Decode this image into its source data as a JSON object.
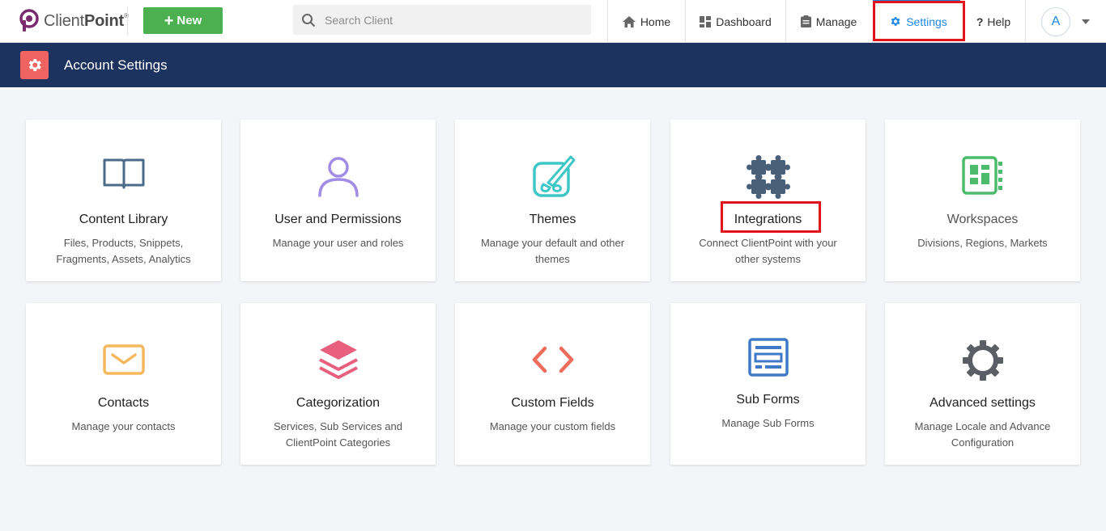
{
  "brand": {
    "name_light": "Client",
    "name_bold": "Point",
    "trademark": "®"
  },
  "toolbar": {
    "new_label": "New"
  },
  "search": {
    "placeholder": "Search Client"
  },
  "nav": {
    "home": "Home",
    "dashboard": "Dashboard",
    "manage": "Manage",
    "settings": "Settings",
    "help": "Help"
  },
  "user": {
    "avatar_initial": "A"
  },
  "page": {
    "title": "Account Settings"
  },
  "colors": {
    "accent": "#1e88e5",
    "new_button": "#4caf50",
    "header_band": "#1c3360",
    "header_icon": "#ef6461",
    "highlight": "#e0141a"
  },
  "cards": [
    {
      "title": "Content Library",
      "desc": "Files, Products, Snippets, Fragments, Assets, Analytics",
      "icon": "book-icon",
      "icon_color": "#4a6b8a"
    },
    {
      "title": "User and Permissions",
      "desc": "Manage your user and roles",
      "icon": "user-icon",
      "icon_color": "#a18ce6"
    },
    {
      "title": "Themes",
      "desc": "Manage your default and other themes",
      "icon": "palette-brush-icon",
      "icon_color": "#3fc6c6"
    },
    {
      "title": "Integrations",
      "desc": "Connect ClientPoint with your other systems",
      "icon": "puzzle-icon",
      "icon_color": "#4a5f78"
    },
    {
      "title": "Workspaces",
      "desc": "Divisions, Regions, Markets",
      "icon": "workspace-icon",
      "icon_color": "#4cbb6c"
    },
    {
      "title": "Contacts",
      "desc": "Manage your contacts",
      "icon": "envelope-icon",
      "icon_color": "#f5b860"
    },
    {
      "title": "Categorization",
      "desc": "Services, Sub Services and ClientPoint Categories",
      "icon": "layers-icon",
      "icon_color": "#e8607e"
    },
    {
      "title": "Custom Fields",
      "desc": "Manage your custom fields",
      "icon": "code-icon",
      "icon_color": "#ee6c5c"
    },
    {
      "title": "Sub Forms",
      "desc": "Manage Sub Forms",
      "icon": "form-icon",
      "icon_color": "#3f7ac9"
    },
    {
      "title": "Advanced settings",
      "desc": "Manage Locale and Advance Configuration",
      "icon": "cog-icon",
      "icon_color": "#5b5e64"
    }
  ]
}
